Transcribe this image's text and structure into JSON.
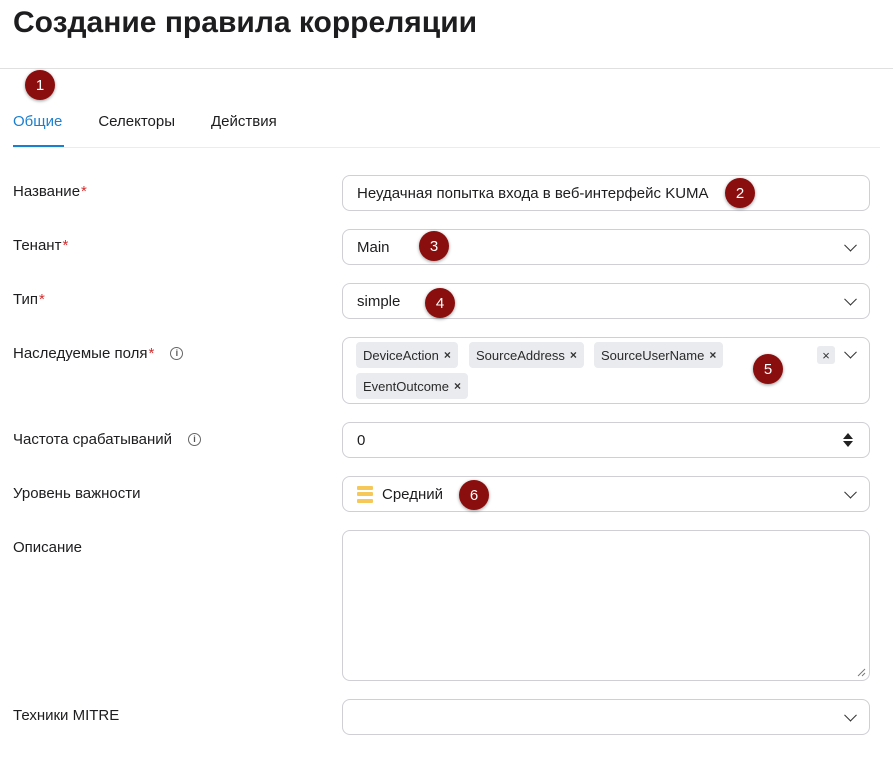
{
  "page": {
    "title": "Создание правила корреляции"
  },
  "tabs": [
    {
      "label": "Общие",
      "active": true
    },
    {
      "label": "Селекторы",
      "active": false
    },
    {
      "label": "Действия",
      "active": false
    }
  ],
  "form": {
    "name": {
      "label": "Название",
      "required": "*",
      "value": "Неудачная попытка входа в веб-интерфейс KUMA"
    },
    "tenant": {
      "label": "Тенант",
      "required": "*",
      "value": "Main"
    },
    "type": {
      "label": "Тип",
      "required": "*",
      "value": "simple"
    },
    "inherited_fields": {
      "label": "Наследуемые поля",
      "required": "*",
      "info_icon": "i",
      "chips": [
        "DeviceAction",
        "SourceAddress",
        "SourceUserName",
        "EventOutcome"
      ],
      "chip_remove": "×",
      "clear_all": "×"
    },
    "frequency": {
      "label": "Частота срабатываний",
      "info_icon": "i",
      "value": "0"
    },
    "severity": {
      "label": "Уровень важности",
      "value": "Средний",
      "color": "#f6c85a"
    },
    "description": {
      "label": "Описание",
      "value": ""
    },
    "mitre": {
      "label": "Техники MITRE",
      "value": ""
    }
  },
  "annotations": [
    "1",
    "2",
    "3",
    "4",
    "5",
    "6"
  ],
  "colors": {
    "accent": "#1a7fcf",
    "required": "#d22d2d",
    "badge": "#8b0e0e"
  }
}
